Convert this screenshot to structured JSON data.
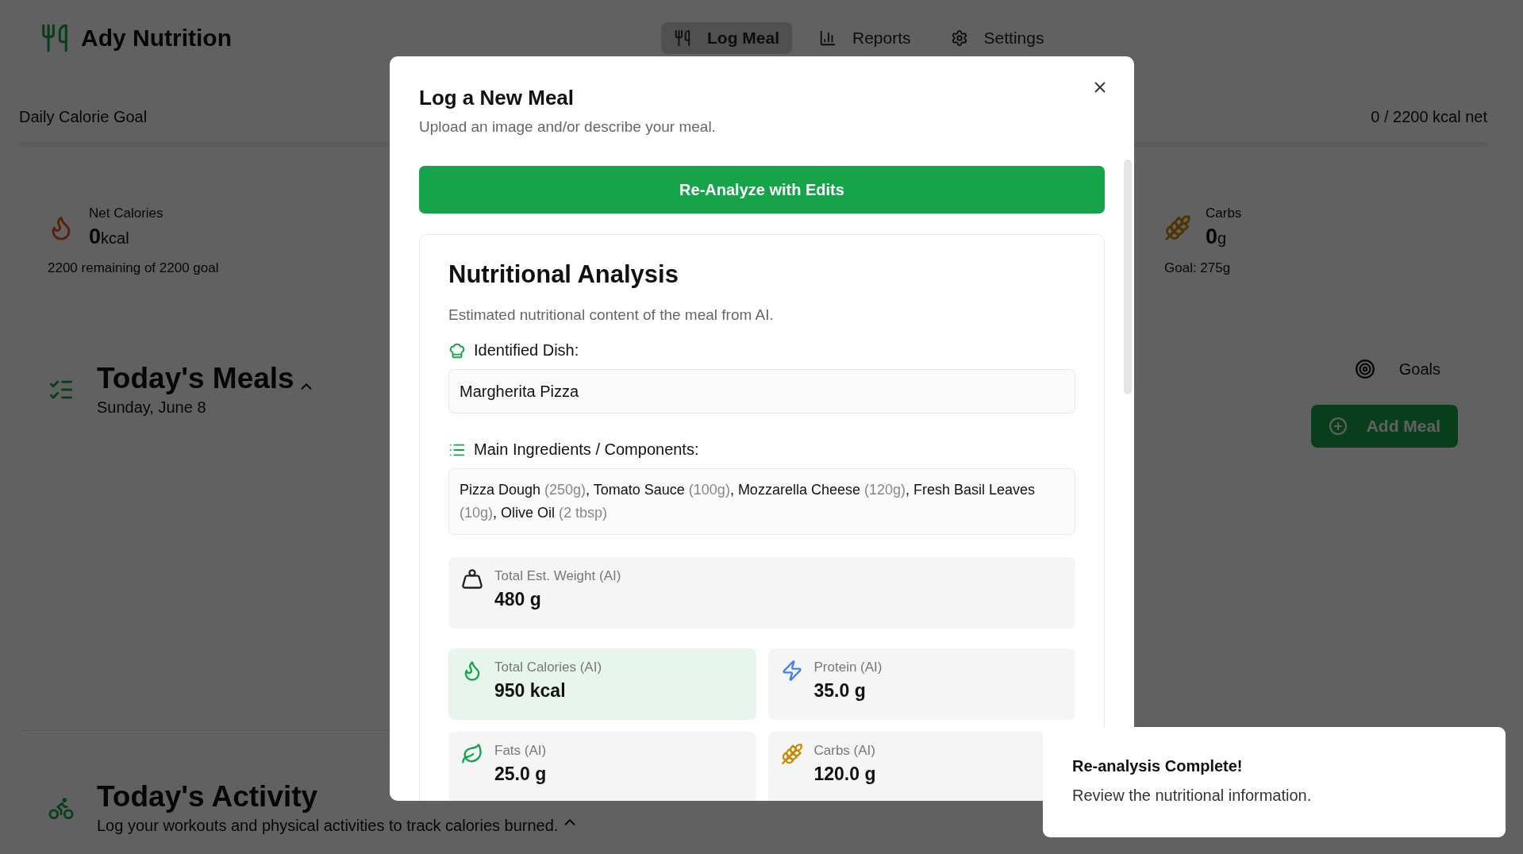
{
  "app": {
    "name": "Ady Nutrition"
  },
  "nav": [
    {
      "label": "Log Meal",
      "selected": true
    },
    {
      "label": "Reports",
      "selected": false
    },
    {
      "label": "Settings",
      "selected": false
    }
  ],
  "calorie_goal": {
    "label": "Daily Calorie Goal",
    "reading": "0 / 2200 kcal net",
    "level": 0
  },
  "stats": [
    {
      "kind": "calories",
      "label": "Net Calories",
      "value": "0",
      "unit": "kcal",
      "note": "2200 remaining of 2200 goal"
    },
    {
      "kind": "carbs",
      "label": "Carbs",
      "value": "0",
      "unit": "g",
      "note": "Goal: 275g"
    }
  ],
  "meals": {
    "title": "Today's Meals",
    "date": "Sunday, June 8",
    "expanded": true,
    "goals_button": "Goals",
    "add_button": "Add Meal"
  },
  "activity": {
    "title": "Today's Activity",
    "subtitle": "Log your workouts and physical activities to track calories burned.",
    "expanded": true
  },
  "modal": {
    "title": "Log a New Meal",
    "subtitle": "Upload an image and/or describe your meal.",
    "action_button": "Re-Analyze with Edits",
    "analysis": {
      "title": "Nutritional Analysis",
      "description": "Estimated nutritional content of the meal from AI.",
      "dish_label": "Identified Dish:",
      "dish": "Margherita Pizza",
      "ingredients_label": "Main Ingredients / Components:",
      "ingredients": "Pizza Dough (250g), Tomato Sauce (100g), Mozzarella Cheese (120g), Fresh Basil Leaves (10g), Olive Oil (2 tbsp)",
      "tiles": [
        {
          "kind": "weight",
          "label": "Total Est. Weight (AI)",
          "value": "480 g",
          "highlighted": false
        },
        {
          "kind": "calories",
          "label": "Total Calories (AI)",
          "value": "950 kcal",
          "highlighted": true
        },
        {
          "kind": "protein",
          "label": "Protein (AI)",
          "value": "35.0 g",
          "highlighted": false
        },
        {
          "kind": "fats",
          "label": "Fats (AI)",
          "value": "25.0 g",
          "highlighted": false
        },
        {
          "kind": "carbs",
          "label": "Carbs (AI)",
          "value": "120.0 g",
          "highlighted": false
        }
      ]
    }
  },
  "toast": {
    "title": "Re-analysis Complete!",
    "message": "Review the nutritional information."
  }
}
